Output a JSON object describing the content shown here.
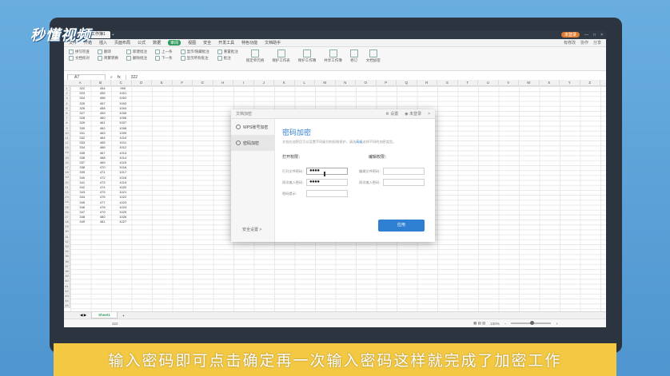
{
  "brand": {
    "logo_text": "秒懂视频"
  },
  "window": {
    "tabs": [
      "稻壳",
      "工作簿1"
    ],
    "new_tab": "+",
    "user_badge": "未登录"
  },
  "menu": {
    "items": [
      "文件",
      "开始",
      "插入",
      "页面布局",
      "公式",
      "数据",
      "审阅",
      "视图",
      "安全",
      "开发工具",
      "特色功能",
      "文档助手"
    ],
    "active_index": 6,
    "right": [
      "有修改",
      "协作",
      "分享"
    ]
  },
  "ribbon": {
    "groups": [
      [
        "拼写检查",
        "文档校对"
      ],
      [
        "翻译",
        "简繁转换"
      ],
      [
        "新建批注",
        "删除批注"
      ],
      [
        "上一条",
        "下一条"
      ],
      [
        "显示/隐藏批注",
        "显示所有批注"
      ],
      [
        "重置批注",
        "批注"
      ],
      [
        "锁定单元格",
        "保护工作表"
      ],
      [
        "保护工作簿",
        "共享工作簿"
      ],
      [
        "修订",
        "文档加密"
      ]
    ]
  },
  "formula": {
    "cell_ref": "A7",
    "fx": "fx",
    "value": "322"
  },
  "columns": [
    "A",
    "B",
    "C",
    "D",
    "E",
    "F",
    "G",
    "H",
    "I",
    "J",
    "K",
    "L",
    "M",
    "N",
    "O",
    "P",
    "Q",
    "R",
    "S",
    "T",
    "U",
    "V",
    "W",
    "X",
    "Y",
    "Z"
  ],
  "rows": [
    "1",
    "2",
    "3",
    "4",
    "5",
    "6",
    "7",
    "8",
    "9",
    "10",
    "11",
    "12",
    "13",
    "14",
    "15",
    "16",
    "17",
    "18",
    "19",
    "20",
    "21",
    "22",
    "23",
    "24",
    "25",
    "26",
    "27",
    "28",
    "29",
    "30",
    "31",
    "32",
    "33",
    "34",
    "35",
    "36",
    "37",
    "38",
    "39",
    "40",
    "41",
    "42",
    "43",
    "44",
    "45"
  ],
  "table": [
    [
      "322",
      "454",
      "990"
    ],
    [
      "323",
      "455",
      "1001"
    ],
    [
      "324",
      "456",
      "1002"
    ],
    [
      "325",
      "457",
      "1003"
    ],
    [
      "326",
      "458",
      "1004"
    ],
    [
      "327",
      "459",
      "1005"
    ],
    [
      "328",
      "460",
      "1006"
    ],
    [
      "329",
      "461",
      "1007"
    ],
    [
      "330",
      "462",
      "1008"
    ],
    [
      "331",
      "463",
      "1009"
    ],
    [
      "332",
      "464",
      "1010"
    ],
    [
      "333",
      "465",
      "1011"
    ],
    [
      "334",
      "466",
      "1012"
    ],
    [
      "335",
      "467",
      "1013"
    ],
    [
      "336",
      "468",
      "1014"
    ],
    [
      "337",
      "469",
      "1015"
    ],
    [
      "338",
      "470",
      "1016"
    ],
    [
      "339",
      "471",
      "1017"
    ],
    [
      "340",
      "472",
      "1018"
    ],
    [
      "341",
      "473",
      "1019"
    ],
    [
      "342",
      "474",
      "1020"
    ],
    [
      "343",
      "475",
      "1021"
    ],
    [
      "344",
      "476",
      "1022"
    ],
    [
      "345",
      "477",
      "1023"
    ],
    [
      "346",
      "478",
      "1024"
    ],
    [
      "347",
      "479",
      "1025"
    ],
    [
      "348",
      "480",
      "1026"
    ],
    [
      "349",
      "481",
      "1027"
    ]
  ],
  "sheet": {
    "tab": "Sheet1",
    "add": "+"
  },
  "status": {
    "left": "322",
    "zoom": "100%"
  },
  "dialog": {
    "title": "文档加密",
    "help": "设置",
    "login": "未登录",
    "close": "×",
    "side_items": [
      "WPS账号加密",
      "密码加密"
    ],
    "side_active": 1,
    "side_footer": "安全设置 >",
    "heading": "密码加密",
    "desc_prefix": "文档在加密后可以设置不同级别的权限保护，请选",
    "desc_link": "高级",
    "desc_suffix": "选择不同的加密类型。",
    "open_section": "打开权限：",
    "edit_section": "编辑权限：",
    "open_fields": [
      {
        "label": "打开文件密码：",
        "value": "●●●●"
      },
      {
        "label": "再次输入密码：",
        "value": "●●●●"
      },
      {
        "label": "密码提示：",
        "value": ""
      }
    ],
    "edit_fields": [
      {
        "label": "编辑文件密码：",
        "value": ""
      },
      {
        "label": "再次输入密码：",
        "value": ""
      }
    ],
    "apply": "应用"
  },
  "caption": "输入密码即可点击确定再一次输入密码这样就完成了加密工作"
}
